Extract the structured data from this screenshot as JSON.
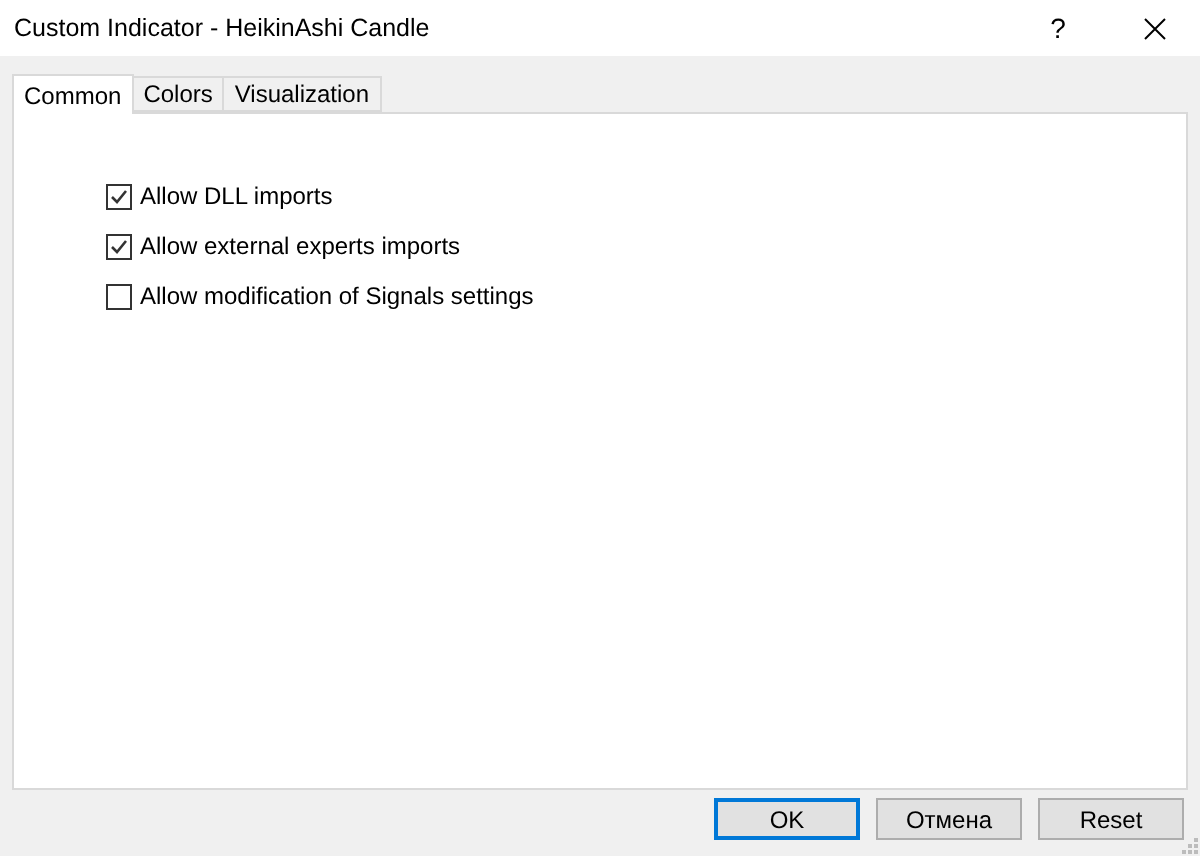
{
  "window": {
    "title": "Custom Indicator - HeikinAshi Candle",
    "help": "?"
  },
  "tabs": [
    {
      "label": "Common",
      "selected": true
    },
    {
      "label": "Colors",
      "selected": false
    },
    {
      "label": "Visualization",
      "selected": false
    }
  ],
  "options": [
    {
      "label": "Allow DLL imports",
      "checked": true
    },
    {
      "label": "Allow external experts imports",
      "checked": true
    },
    {
      "label": "Allow modification of Signals settings",
      "checked": false
    }
  ],
  "buttons": [
    {
      "label": "OK",
      "default": true
    },
    {
      "label": "Отмена",
      "default": false
    },
    {
      "label": "Reset",
      "default": false
    }
  ]
}
